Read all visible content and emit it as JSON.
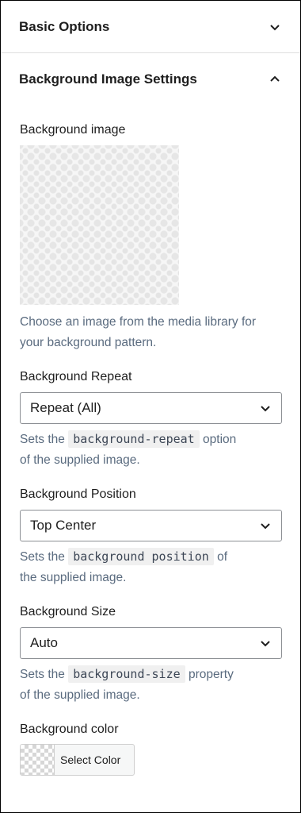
{
  "panels": {
    "basic_options": {
      "title": "Basic Options",
      "icon": "chevron-down-icon",
      "expanded": false
    },
    "background_image_settings": {
      "title": "Background Image Settings",
      "icon": "chevron-up-icon",
      "expanded": true
    }
  },
  "background_image": {
    "label": "Background image",
    "help": "Choose an image from the media library for your background pattern."
  },
  "background_repeat": {
    "label": "Background Repeat",
    "value": "Repeat (All)",
    "help_prefix": "Sets the",
    "help_code": "background-repeat",
    "help_suffix_1": "option",
    "help_suffix_2": "of the supplied image."
  },
  "background_position": {
    "label": "Background Position",
    "value": "Top Center",
    "help_prefix": "Sets the",
    "help_code": "background position",
    "help_suffix_1": "of",
    "help_suffix_2": "the supplied image."
  },
  "background_size": {
    "label": "Background Size",
    "value": "Auto",
    "help_prefix": "Sets the",
    "help_code": "background-size",
    "help_suffix_1": "property",
    "help_suffix_2": "of the supplied image."
  },
  "background_color": {
    "label": "Background color",
    "button_label": "Select Color"
  },
  "colors": {
    "text": "#1e1e1e",
    "help_text": "#5a6b7f",
    "border": "#8c8f94",
    "code_bg": "#f0f0f0"
  }
}
